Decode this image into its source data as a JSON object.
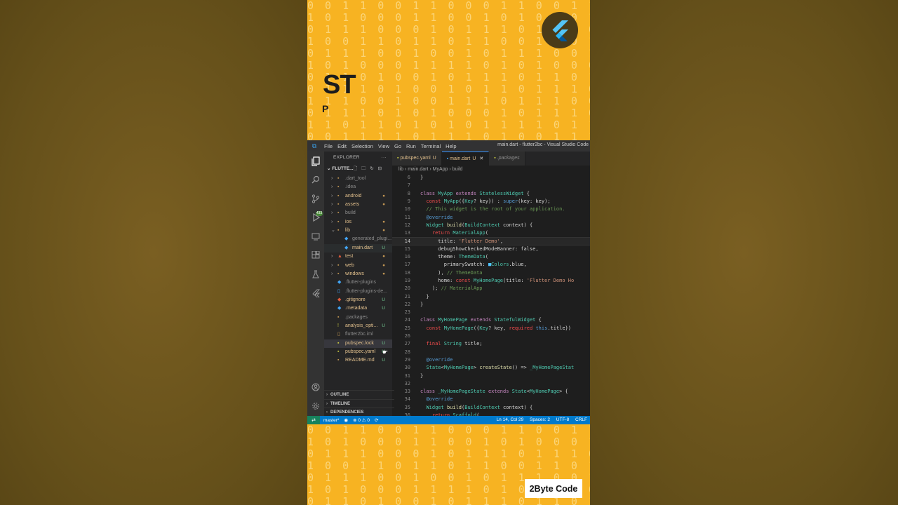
{
  "overlay": {
    "headline": "ST",
    "subline": "P",
    "brand": "2Byte Code",
    "binary_rows_top": [
      "0 0 1 1 0 0 1 1 0 0 0 1 1 0 0 1 1 0 0 0 1",
      "1 0 1 0 0 0 1 1 0 0 1 0 1 0 0 0 1 1 0 0 1",
      "0 1 1 1 0 0 0 1 0 1 1 1 0 1 1 1 0 0 0 1 0",
      "1 0 0 1 1 0 1 1 0 1 1 0 0 1 1 0 1 1 0 1 1",
      "0 1 1 1 0 0 1 0 0 1 0 1 1 1 0 0 1 0 0 1 0",
      "1 0 1 0 0 0 1 1 1 1 0 1 0 1 0 0 0 1 1 1 1",
      "0 1 1 0 1 0 0 1 0 1 1 1 0 1 1 0 1 0 0 1 0",
      "0 1 1 1 0 1 0 0 1 0 1 1 0 1 1 1 0 1 0 0 1",
      "1 1 1 0 0 1 0 0 1 1 1 0 1 1 1 0 0 1 0 0 1",
      "0 1 1 1 0 1 0 1 0 0 0 1 0 1 1 1 0 1 0 1 0",
      "1 1 0 1 1 0 1 0 1 0 1 1 1 1 0 1 1 0 1 0 1",
      "0 0 1 1 1 1 0 1 1 1 0 1 0 0 1 1 1 1 0 1 1",
      "1 1 1 0 0 0 0 1 1 0 1 1 1 1 1 0 0 0 0 1 1"
    ],
    "binary_rows_bottom": [
      "0 0 1 1 0 0 1 1 0 0 0 1 1 0 0 1 1 0 0 0 1",
      "1 0 1 0 0 0 1 1 0 0 1 0 1 0 0 0 1 1 0 0 1",
      "0 1 1 1 0 0 0 1 0 1 1 1 0 1 1 1 0 0 0 1 0",
      "1 0 0 1 1 0 1 1 0 1 1 0 0 1 1 0 1 1 0 1 1",
      "0 1 1 1 0 0 1 0 0 1 0 1 1 1 0 0 1 0 0 1 0",
      "1 0 1 0 0 0 1 1 1 1 0 1 0 1 0 0 0 1 1 1 1",
      "0 1 1 0 1 0 0 1 0 1 1 1 0 1 1 0 1 0 0 1 0"
    ]
  },
  "titlebar": {
    "menu": [
      "File",
      "Edit",
      "Selection",
      "View",
      "Go",
      "Run",
      "Terminal",
      "Help"
    ],
    "window_title": "main.dart - flutter2bc - Visual Studio Code"
  },
  "activity": {
    "badge": "433"
  },
  "explorer": {
    "header": "EXPLORER",
    "dots": "···",
    "folder": "FLUTTE...",
    "folder_chev": "⌄",
    "folder_tools": "🗋 🗀 ↻ ⊟",
    "items": [
      {
        "label": ".dart_tool",
        "chev": "›",
        "icon": "▪",
        "color": "#8c8c8c",
        "status": "",
        "depth": 0
      },
      {
        "label": ".idea",
        "chev": "›",
        "icon": "▪",
        "color": "#8c8c8c",
        "status": "",
        "depth": 0
      },
      {
        "label": "android",
        "chev": "›",
        "icon": "▪",
        "color": "#e2c08d",
        "status": "●",
        "depth": 0
      },
      {
        "label": "assets",
        "chev": "›",
        "icon": "▪",
        "color": "#e2c08d",
        "status": "●",
        "depth": 0
      },
      {
        "label": "build",
        "chev": "›",
        "icon": "▪",
        "color": "#8c8c8c",
        "status": "",
        "depth": 0
      },
      {
        "label": "ios",
        "chev": "›",
        "icon": "▪",
        "color": "#e2c08d",
        "status": "●",
        "depth": 0
      },
      {
        "label": "lib",
        "chev": "⌄",
        "icon": "▪",
        "color": "#e2c08d",
        "status": "●",
        "depth": 0
      },
      {
        "label": "generated_plugi...",
        "chev": "",
        "icon": "◆",
        "color": "#8c8c8c",
        "status": "",
        "depth": 1
      },
      {
        "label": "main.dart",
        "chev": "",
        "icon": "◆",
        "color": "#e2c08d",
        "status": "U",
        "depth": 1
      },
      {
        "label": "test",
        "chev": "›",
        "icon": "▲",
        "color": "#e2c08d",
        "status": "●",
        "depth": 0
      },
      {
        "label": "web",
        "chev": "›",
        "icon": "▪",
        "color": "#e2c08d",
        "status": "●",
        "depth": 0
      },
      {
        "label": "windows",
        "chev": "›",
        "icon": "▪",
        "color": "#e2c08d",
        "status": "●",
        "depth": 0
      },
      {
        "label": ".flutter-plugins",
        "chev": "",
        "icon": "◆",
        "color": "#8c8c8c",
        "status": "",
        "depth": 0
      },
      {
        "label": ".flutter-plugins-de...",
        "chev": "",
        "icon": "▯",
        "color": "#8c8c8c",
        "status": "",
        "depth": 0
      },
      {
        "label": ".gitignore",
        "chev": "",
        "icon": "◆",
        "color": "#e2c08d",
        "status": "U",
        "depth": 0
      },
      {
        "label": ".metadata",
        "chev": "",
        "icon": "◆",
        "color": "#e2c08d",
        "status": "U",
        "depth": 0
      },
      {
        "label": ".packages",
        "chev": "",
        "icon": "▪",
        "color": "#8c8c8c",
        "status": "",
        "depth": 0
      },
      {
        "label": "analysis_opti...",
        "chev": "",
        "icon": "!",
        "color": "#e2c08d",
        "status": "U",
        "depth": 0
      },
      {
        "label": "flutter2bc.iml",
        "chev": "",
        "icon": "▯",
        "color": "#8c8c8c",
        "status": "",
        "depth": 0
      },
      {
        "label": "pubspec.lock",
        "chev": "",
        "icon": "▪",
        "color": "#e2c08d",
        "status": "U",
        "depth": 0
      },
      {
        "label": "pubspec.yaml",
        "chev": "",
        "icon": "▪",
        "color": "#e2c08d",
        "status": "U",
        "depth": 0
      },
      {
        "label": "README.md",
        "chev": "",
        "icon": "▪",
        "color": "#e2c08d",
        "status": "U",
        "depth": 0
      }
    ],
    "sections": [
      "OUTLINE",
      "TIMELINE",
      "DEPENDENCIES"
    ],
    "section_chev": "›"
  },
  "tabs": [
    {
      "label": "pubspec.yaml",
      "status": "U",
      "close": ""
    },
    {
      "label": "main.dart",
      "status": "U",
      "close": "✕"
    },
    {
      "label": ".packages",
      "status": "",
      "close": ""
    }
  ],
  "breadcrumb": "lib  ›  main.dart  ›  MyApp  ›  build",
  "code": {
    "current_line": 14,
    "lines": [
      {
        "n": 6,
        "segs": [
          [
            "}",
            "pl"
          ]
        ]
      },
      {
        "n": 7,
        "segs": []
      },
      {
        "n": 8,
        "segs": [
          [
            "class ",
            "k"
          ],
          [
            "MyApp ",
            "cls"
          ],
          [
            "extends ",
            "k"
          ],
          [
            "StatelessWidget",
            "cls"
          ],
          [
            " {",
            "pl"
          ]
        ]
      },
      {
        "n": 9,
        "segs": [
          [
            "  ",
            "pl"
          ],
          [
            "const ",
            "kw2"
          ],
          [
            "MyApp",
            "cls"
          ],
          [
            "({",
            "pl"
          ],
          [
            "Key",
            "cls"
          ],
          [
            "? key}) : ",
            "pl"
          ],
          [
            "super",
            "kb"
          ],
          [
            "(key: key);",
            "pl"
          ]
        ]
      },
      {
        "n": 10,
        "segs": [
          [
            "  // This widget is the root of your application.",
            "cm"
          ]
        ]
      },
      {
        "n": 11,
        "segs": [
          [
            "  @override",
            "kb"
          ]
        ]
      },
      {
        "n": 12,
        "segs": [
          [
            "  ",
            "pl"
          ],
          [
            "Widget ",
            "cls"
          ],
          [
            "build",
            "fn"
          ],
          [
            "(",
            "pl"
          ],
          [
            "BuildContext ",
            "cls"
          ],
          [
            "context) {",
            "pl"
          ]
        ]
      },
      {
        "n": 13,
        "segs": [
          [
            "    ",
            "pl"
          ],
          [
            "return ",
            "kw2"
          ],
          [
            "MaterialApp",
            "cls"
          ],
          [
            "(",
            "pl"
          ]
        ]
      },
      {
        "n": 14,
        "segs": [
          [
            "      title: ",
            "pl"
          ],
          [
            "'Flutter Demo'",
            "s"
          ],
          [
            ",",
            "pl"
          ]
        ]
      },
      {
        "n": 15,
        "segs": [
          [
            "      debugShowCheckedModeBanner: false,",
            "pl"
          ]
        ]
      },
      {
        "n": 16,
        "segs": [
          [
            "      theme: ",
            "pl"
          ],
          [
            "ThemeData",
            "cls"
          ],
          [
            "(",
            "pl"
          ]
        ]
      },
      {
        "n": 17,
        "segs": [
          [
            "        primarySwatch: ",
            "pl"
          ],
          [
            "■",
            "at"
          ],
          [
            "Colors",
            "cls"
          ],
          [
            ".blue,",
            "pl"
          ]
        ]
      },
      {
        "n": 18,
        "segs": [
          [
            "      ), ",
            "pl"
          ],
          [
            "// ThemeData",
            "cm"
          ]
        ]
      },
      {
        "n": 19,
        "segs": [
          [
            "      home: ",
            "pl"
          ],
          [
            "const ",
            "kw2"
          ],
          [
            "MyHomePage",
            "cls"
          ],
          [
            "(title: ",
            "pl"
          ],
          [
            "'Flutter Demo Ho",
            "s"
          ]
        ]
      },
      {
        "n": 20,
        "segs": [
          [
            "    ); ",
            "pl"
          ],
          [
            "// MaterialApp",
            "cm"
          ]
        ]
      },
      {
        "n": 21,
        "segs": [
          [
            "  }",
            "pl"
          ]
        ]
      },
      {
        "n": 22,
        "segs": [
          [
            "}",
            "pl"
          ]
        ]
      },
      {
        "n": 23,
        "segs": []
      },
      {
        "n": 24,
        "segs": [
          [
            "class ",
            "k"
          ],
          [
            "MyHomePage ",
            "cls"
          ],
          [
            "extends ",
            "k"
          ],
          [
            "StatefulWidget",
            "cls"
          ],
          [
            " {",
            "pl"
          ]
        ]
      },
      {
        "n": 25,
        "segs": [
          [
            "  ",
            "pl"
          ],
          [
            "const ",
            "kw2"
          ],
          [
            "MyHomePage",
            "cls"
          ],
          [
            "({",
            "pl"
          ],
          [
            "Key",
            "cls"
          ],
          [
            "? key, ",
            "pl"
          ],
          [
            "required ",
            "kw2"
          ],
          [
            "this",
            "kb"
          ],
          [
            ".title})",
            "pl"
          ]
        ]
      },
      {
        "n": 26,
        "segs": []
      },
      {
        "n": 27,
        "segs": [
          [
            "  ",
            "pl"
          ],
          [
            "final ",
            "kw2"
          ],
          [
            "String ",
            "cls"
          ],
          [
            "title;",
            "pl"
          ]
        ]
      },
      {
        "n": 28,
        "segs": []
      },
      {
        "n": 29,
        "segs": [
          [
            "  @override",
            "kb"
          ]
        ]
      },
      {
        "n": 30,
        "segs": [
          [
            "  ",
            "pl"
          ],
          [
            "State",
            "cls"
          ],
          [
            "<",
            "pl"
          ],
          [
            "MyHomePage",
            "cls"
          ],
          [
            "> ",
            "pl"
          ],
          [
            "createState",
            "fn"
          ],
          [
            "() => ",
            "pl"
          ],
          [
            "_MyHomePageStat",
            "cls"
          ]
        ]
      },
      {
        "n": 31,
        "segs": [
          [
            "}",
            "pl"
          ]
        ]
      },
      {
        "n": 32,
        "segs": []
      },
      {
        "n": 33,
        "segs": [
          [
            "class ",
            "k"
          ],
          [
            "_MyHomePageState ",
            "cls"
          ],
          [
            "extends ",
            "k"
          ],
          [
            "State",
            "cls"
          ],
          [
            "<",
            "pl"
          ],
          [
            "MyHomePage",
            "cls"
          ],
          [
            "> {",
            "pl"
          ]
        ]
      },
      {
        "n": 34,
        "segs": [
          [
            "  @override",
            "kb"
          ]
        ]
      },
      {
        "n": 35,
        "segs": [
          [
            "  ",
            "pl"
          ],
          [
            "Widget ",
            "cls"
          ],
          [
            "build",
            "fn"
          ],
          [
            "(",
            "pl"
          ],
          [
            "BuildContext ",
            "cls"
          ],
          [
            "context) {",
            "pl"
          ]
        ]
      },
      {
        "n": 36,
        "segs": [
          [
            "    ",
            "pl"
          ],
          [
            "return ",
            "kw2"
          ],
          [
            "Scaffold",
            "cls"
          ],
          [
            "(",
            "pl"
          ]
        ]
      }
    ]
  },
  "status": {
    "remote": "⇄",
    "branch": "master*",
    "eye": "◉",
    "problems": "⊗ 0 ⚠ 0",
    "sync": "⟳",
    "position": "Ln 14, Col 29",
    "spaces": "Spaces: 2",
    "encoding": "UTF-8",
    "eol": "CRLF"
  }
}
